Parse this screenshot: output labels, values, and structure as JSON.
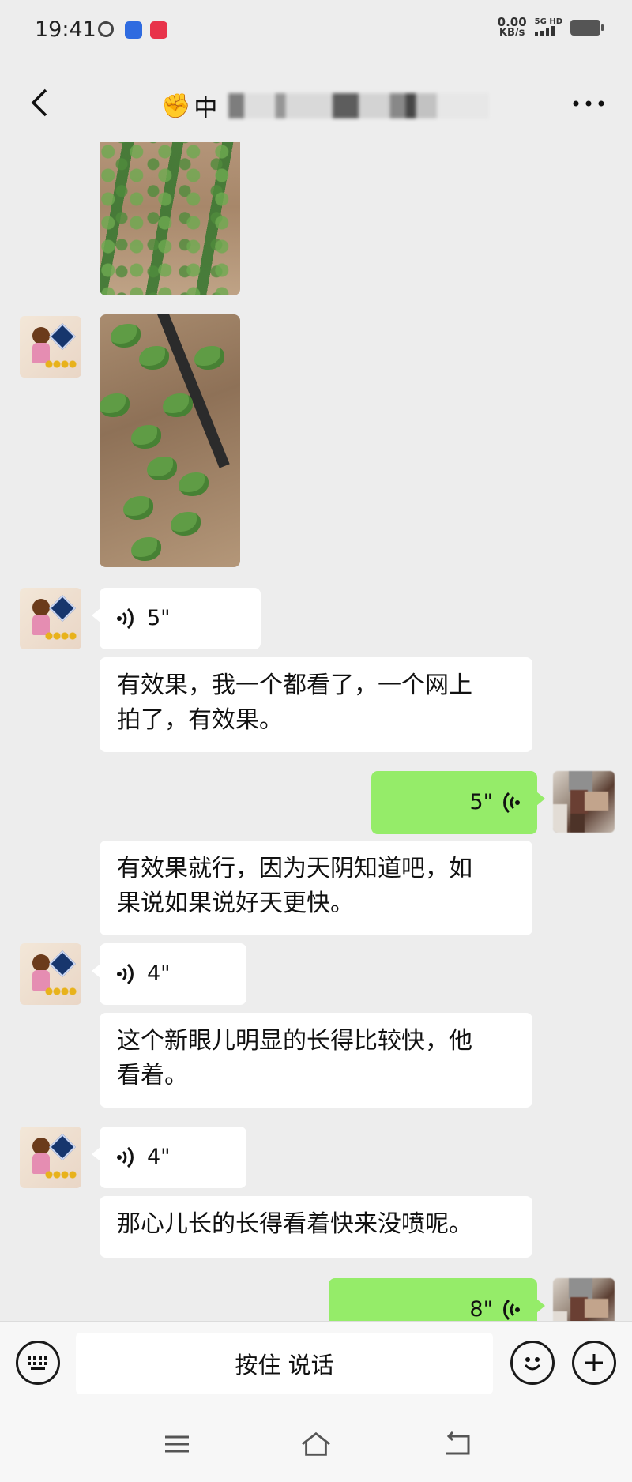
{
  "status_bar": {
    "time": "19:41",
    "net_speed_value": "0.00",
    "net_speed_unit": "KB/s",
    "signal_label": "5G HD"
  },
  "header": {
    "title_visible": "中",
    "title_emoji": "✊"
  },
  "messages": [
    {
      "side": "left",
      "type": "image",
      "content": "strawberry-field-photo-1"
    },
    {
      "side": "left",
      "type": "image",
      "content": "strawberry-plants-photo-2"
    },
    {
      "side": "left",
      "type": "voice",
      "duration": "5\""
    },
    {
      "side": "left",
      "type": "text",
      "lines": [
        "有效果，我一个都看了，一个网上",
        "拍了，有效果。"
      ]
    },
    {
      "side": "right",
      "type": "voice",
      "duration": "5\""
    },
    {
      "side": "left",
      "type": "text",
      "lines": [
        "有效果就行，因为天阴知道吧，如",
        "果说如果说好天更快。"
      ]
    },
    {
      "side": "left",
      "type": "voice",
      "duration": "4\""
    },
    {
      "side": "left",
      "type": "text",
      "lines": [
        "这个新眼儿明显的长得比较快，他",
        "看着。"
      ]
    },
    {
      "side": "left",
      "type": "voice",
      "duration": "4\""
    },
    {
      "side": "left",
      "type": "text",
      "lines": [
        "那心儿长的长得看着快来没喷呢。"
      ]
    },
    {
      "side": "right",
      "type": "voice",
      "duration": "8\""
    }
  ],
  "input_bar": {
    "talk_label": "按住 说话"
  },
  "colors": {
    "background": "#ededed",
    "outgoing_bubble": "#95ec69",
    "incoming_bubble": "#ffffff"
  },
  "icons": [
    "back-icon",
    "more-icon",
    "voice-wave-icon",
    "keyboard-icon",
    "emoji-icon",
    "plus-icon",
    "menu-icon",
    "home-icon",
    "return-icon"
  ]
}
